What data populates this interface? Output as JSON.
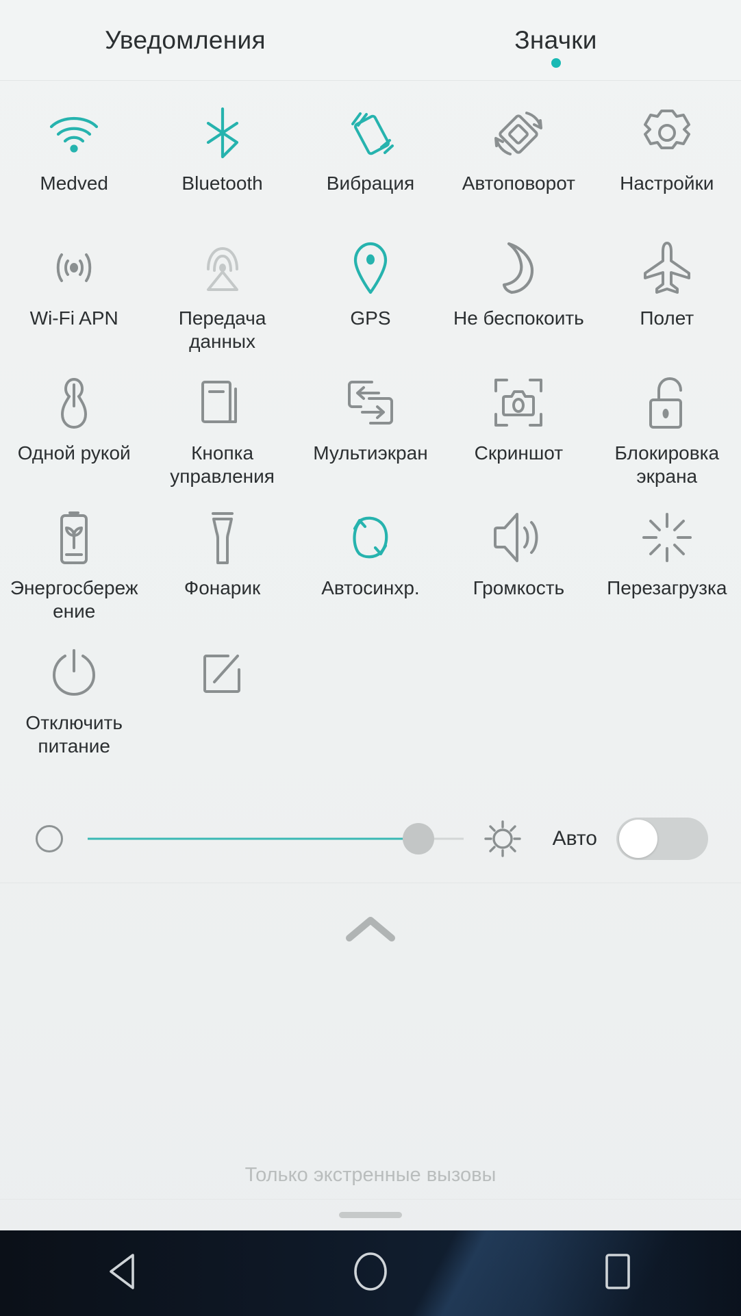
{
  "colors": {
    "accent": "#19b9b4",
    "icon_active": "#26b3ae",
    "icon_inactive": "#8a8f90",
    "icon_disabled": "#c4c8c8",
    "text": "#2b2f31",
    "text_muted": "#b9bdbd",
    "panel_bg": "#f1f3f3",
    "navbar_bg": "#0c1420"
  },
  "header": {
    "tabs": [
      {
        "label": "Уведомления",
        "active": false
      },
      {
        "label": "Значки",
        "active": true
      }
    ]
  },
  "tiles": [
    [
      {
        "label": "Medved",
        "icon": "wifi-icon",
        "state": "active"
      },
      {
        "label": "Bluetooth",
        "icon": "bluetooth-icon",
        "state": "active"
      },
      {
        "label": "Вибрация",
        "icon": "vibration-icon",
        "state": "active"
      },
      {
        "label": "Автоповорот",
        "icon": "auto-rotate-icon",
        "state": "inactive"
      },
      {
        "label": "Настройки",
        "icon": "gear-icon",
        "state": "inactive"
      }
    ],
    [
      {
        "label": "Wi-Fi APN",
        "icon": "hotspot-icon",
        "state": "inactive"
      },
      {
        "label": "Передача\nданных",
        "icon": "mobile-data-icon",
        "state": "disabled"
      },
      {
        "label": "GPS",
        "icon": "location-pin-icon",
        "state": "active"
      },
      {
        "label": "Не беспокоить",
        "icon": "moon-icon",
        "state": "inactive"
      },
      {
        "label": "Полет",
        "icon": "airplane-icon",
        "state": "inactive"
      }
    ],
    [
      {
        "label": "Одной рукой",
        "icon": "one-hand-icon",
        "state": "inactive"
      },
      {
        "label": "Кнопка\nуправления",
        "icon": "navigation-dock-icon",
        "state": "inactive"
      },
      {
        "label": "Мультиэкран",
        "icon": "multi-screen-icon",
        "state": "inactive"
      },
      {
        "label": "Скриншот",
        "icon": "screenshot-icon",
        "state": "inactive"
      },
      {
        "label": "Блокировка\nэкрана",
        "icon": "lock-icon",
        "state": "inactive"
      }
    ],
    [
      {
        "label": "Энергосбереж\nение",
        "icon": "battery-saver-icon",
        "state": "inactive"
      },
      {
        "label": "Фонарик",
        "icon": "flashlight-icon",
        "state": "inactive"
      },
      {
        "label": "Автосинхр.",
        "icon": "sync-icon",
        "state": "active"
      },
      {
        "label": "Громкость",
        "icon": "volume-icon",
        "state": "inactive"
      },
      {
        "label": "Перезагрузка",
        "icon": "restart-icon",
        "state": "inactive"
      }
    ],
    [
      {
        "label": "Отключить\nпитание",
        "icon": "power-icon",
        "state": "inactive"
      },
      {
        "label": "",
        "icon": "edit-tiles-icon",
        "state": "inactive"
      },
      {
        "label": "",
        "icon": "",
        "state": "empty"
      },
      {
        "label": "",
        "icon": "",
        "state": "empty"
      },
      {
        "label": "",
        "icon": "",
        "state": "empty"
      }
    ]
  ],
  "brightness": {
    "low_icon": "brightness-low-icon",
    "sun_icon": "brightness-high-icon",
    "value_percent": 88,
    "auto_label": "Авто",
    "auto_enabled": false
  },
  "footer": {
    "collapse_icon": "chevron-up-icon",
    "status_text": "Только экстренные вызовы",
    "drag_handle": "drag-handle"
  },
  "navbar": {
    "buttons": [
      {
        "name": "back-button",
        "icon": "triangle-back-icon"
      },
      {
        "name": "home-button",
        "icon": "circle-home-icon"
      },
      {
        "name": "recents-button",
        "icon": "square-recents-icon"
      }
    ]
  }
}
